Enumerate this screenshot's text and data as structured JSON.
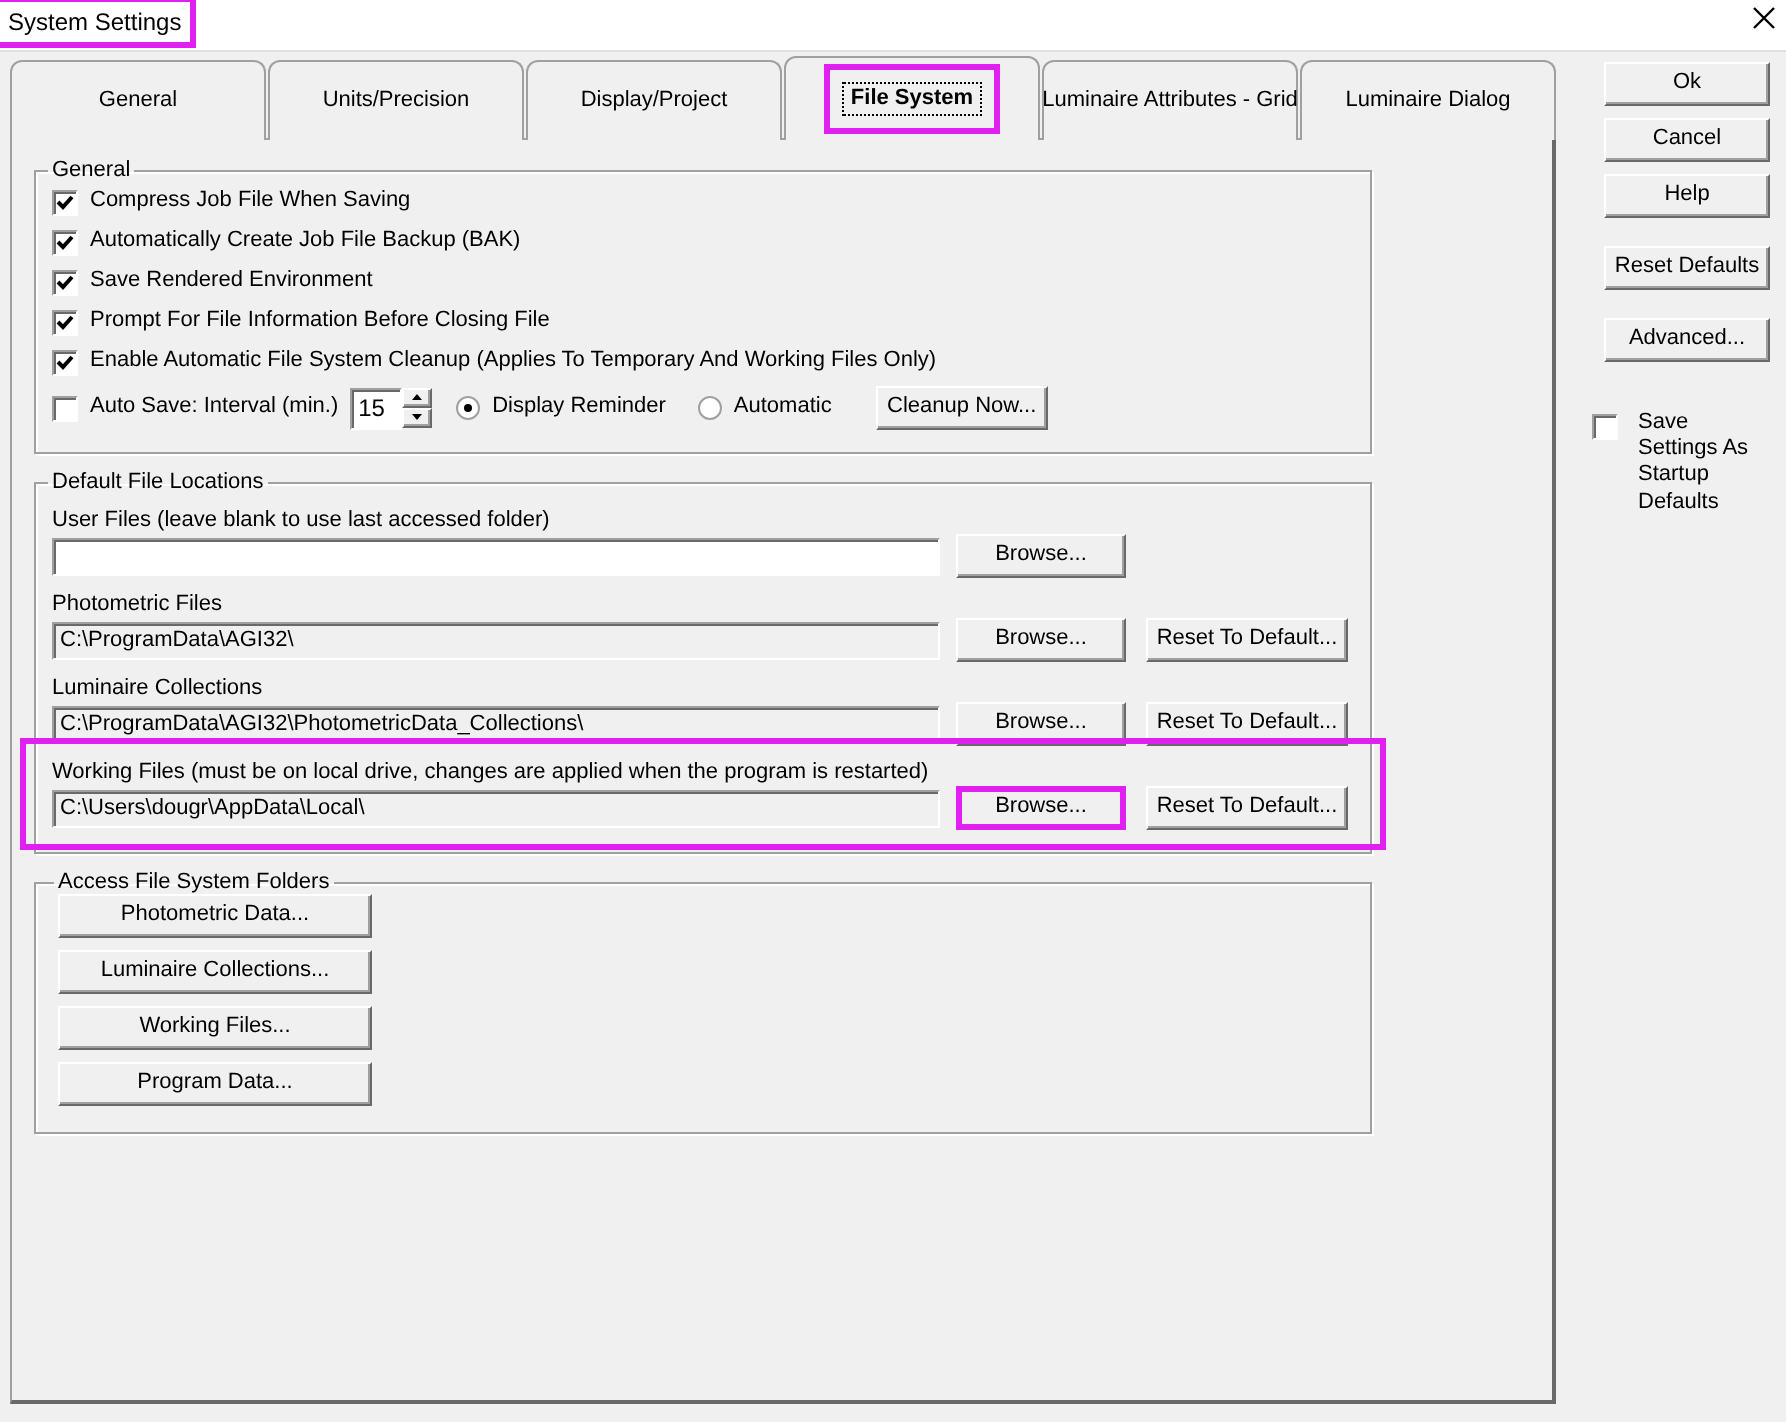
{
  "window": {
    "title": "System Settings",
    "highlighted": true
  },
  "tabs": [
    {
      "label": "General",
      "selected": false,
      "highlighted": false
    },
    {
      "label": "Units/Precision",
      "selected": false,
      "highlighted": false
    },
    {
      "label": "Display/Project",
      "selected": false,
      "highlighted": false
    },
    {
      "label": "File System",
      "selected": true,
      "highlighted": true
    },
    {
      "label": "Luminaire Attributes - Grid",
      "selected": false,
      "highlighted": false
    },
    {
      "label": "Luminaire Dialog",
      "selected": false,
      "highlighted": false
    }
  ],
  "general": {
    "title": "General",
    "checkboxes": [
      {
        "label": "Compress Job File When Saving",
        "checked": true
      },
      {
        "label": "Automatically Create Job File Backup (BAK)",
        "checked": true
      },
      {
        "label": "Save Rendered Environment",
        "checked": true
      },
      {
        "label": "Prompt For File Information Before Closing File",
        "checked": true
      },
      {
        "label": "Enable Automatic File System Cleanup (Applies To Temporary And Working Files Only)",
        "checked": true
      }
    ],
    "autosave": {
      "label": "Auto Save: Interval (min.)",
      "checked": false,
      "interval": "15",
      "options": [
        {
          "label": "Display Reminder",
          "selected": true
        },
        {
          "label": "Automatic",
          "selected": false
        }
      ],
      "button": "Cleanup Now..."
    }
  },
  "locations": {
    "title": "Default File Locations",
    "rows": [
      {
        "label": "User Files (leave blank to use last accessed folder)",
        "disabled": false,
        "browse": "Browse...",
        "highlighted": false,
        "browse_highlighted": false
      },
      {
        "label": "Photometric Files",
        "value": "C:\\ProgramData\\AGI32\\",
        "disabled": true,
        "browse": "Browse...",
        "reset": "Reset To Default...",
        "highlighted": false,
        "browse_highlighted": false
      },
      {
        "label": "Luminaire Collections",
        "value": "C:\\ProgramData\\AGI32\\PhotometricData_Collections\\",
        "disabled": true,
        "browse": "Browse...",
        "reset": "Reset To Default...",
        "highlighted": false,
        "browse_highlighted": false
      },
      {
        "label": "Working Files (must be on local drive, changes are applied when the program is restarted)",
        "value": "C:\\Users\\dougr\\AppData\\Local\\",
        "disabled": true,
        "browse": "Browse...",
        "reset": "Reset To Default...",
        "highlighted": true,
        "browse_highlighted": true
      }
    ]
  },
  "access": {
    "title": "Access File System Folders",
    "buttons": [
      "Photometric Data...",
      "Luminaire Collections...",
      "Working Files...",
      "Program Data..."
    ]
  },
  "side_buttons": [
    {
      "label": "Ok"
    },
    {
      "label": "Cancel"
    },
    {
      "label": "Help"
    },
    {
      "label": "Reset Defaults"
    },
    {
      "label": "Advanced..."
    }
  ],
  "startup": {
    "label": "Save Settings As Startup Defaults",
    "checked": false
  }
}
